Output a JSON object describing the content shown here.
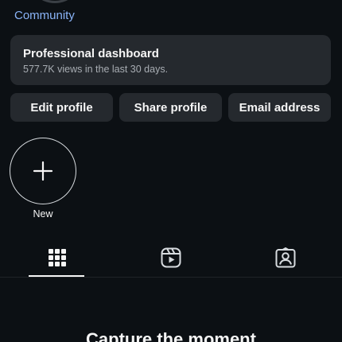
{
  "profile": {
    "category_label": "Community"
  },
  "dashboard": {
    "title": "Professional dashboard",
    "subtitle": "577.7K views in the last 30 days."
  },
  "actions": {
    "edit_label": "Edit profile",
    "share_label": "Share profile",
    "email_label": "Email address"
  },
  "highlights": {
    "new_label": "New",
    "new_icon": "plus-icon"
  },
  "tabs": [
    {
      "icon": "grid-icon",
      "active": true
    },
    {
      "icon": "reels-icon",
      "active": false
    },
    {
      "icon": "tagged-icon",
      "active": false
    }
  ],
  "empty_state": {
    "title": "Capture the moment"
  },
  "colors": {
    "background": "#0c1014",
    "card": "#25292e",
    "link": "#8ab4f8",
    "text": "#f5f5f5"
  }
}
